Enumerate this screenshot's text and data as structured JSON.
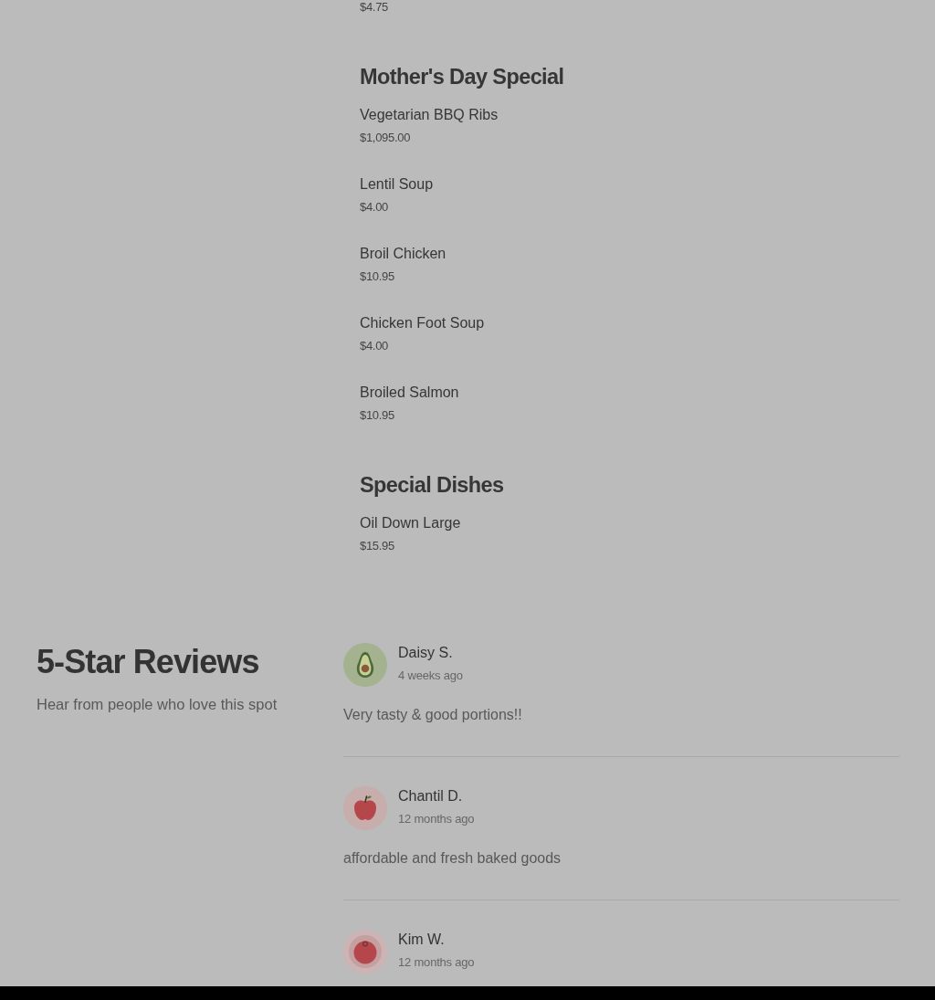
{
  "menu": {
    "sections": [
      {
        "items": [
          {
            "price": "$4.75"
          }
        ]
      },
      {
        "title": "Mother's Day Special",
        "items": [
          {
            "name": "Vegetarian BBQ Ribs",
            "price": "$1,095.00"
          },
          {
            "name": "Lentil Soup",
            "price": "$4.00"
          },
          {
            "name": "Broil Chicken",
            "price": "$10.95"
          },
          {
            "name": "Chicken Foot Soup",
            "price": "$4.00"
          },
          {
            "name": "Broiled Salmon",
            "price": "$10.95"
          }
        ]
      },
      {
        "title": "Special Dishes",
        "items": [
          {
            "name": "Oil Down Large",
            "price": "$15.95"
          }
        ]
      }
    ]
  },
  "reviews": {
    "title": "5-Star Reviews",
    "subtitle": "Hear from people who love this spot",
    "items": [
      {
        "kind": "avocado",
        "name": "Daisy S.",
        "time": "4 weeks ago",
        "text": "Very tasty & good portions!!"
      },
      {
        "kind": "apple",
        "name": "Chantil D.",
        "time": "12 months ago",
        "text": "affordable and fresh baked goods"
      },
      {
        "kind": "tomato",
        "name": "Kim W.",
        "time": "12 months ago"
      }
    ]
  }
}
